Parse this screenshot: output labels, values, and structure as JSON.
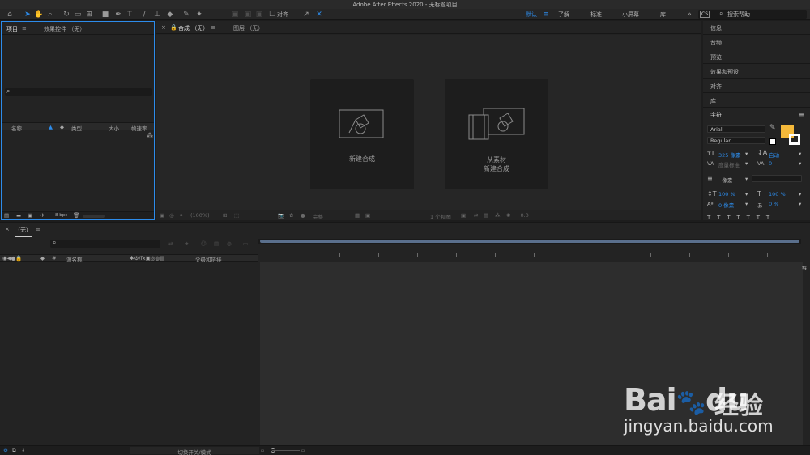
{
  "window": {
    "title": "Adobe After Effects 2020 - 无标题项目"
  },
  "toolbar": {
    "snap_label": "对齐",
    "workspaces": [
      "默认",
      "了解",
      "标准",
      "小屏幕",
      "库"
    ],
    "active_workspace": "默认",
    "search_placeholder": "搜索帮助"
  },
  "project_panel": {
    "tabs": [
      "项目",
      "效果控件 （无）"
    ],
    "columns": [
      "名称",
      "类型",
      "大小",
      "帧速率"
    ],
    "footer_bpc": "8 bpc"
  },
  "comp_panel": {
    "tabs": [
      "合成 （无）",
      "图层 （无）"
    ],
    "cards": [
      {
        "label_lines": [
          "新建合成"
        ]
      },
      {
        "label_lines": [
          "从素材",
          "新建合成"
        ]
      }
    ],
    "footer": {
      "zoom": "(100%)",
      "quality": "完整",
      "views": "1 个视图",
      "exposure": "+0.0"
    }
  },
  "right_panel": {
    "items": [
      "信息",
      "音频",
      "预览",
      "效果和预设",
      "对齐",
      "库"
    ],
    "character": {
      "title": "字符",
      "font": "Arial",
      "style": "Regular",
      "size": "325 像素",
      "leading": "自动",
      "kerning": "度量标准",
      "tracking": "0",
      "stroke": "- 像素",
      "vscale": "100 %",
      "hscale": "100 %",
      "baseline": "0 像素",
      "tsume": "0 %"
    },
    "fill_color": "#f5b93a"
  },
  "timeline": {
    "tab": "（无）",
    "columns": [
      "源名称",
      "父级和链接"
    ],
    "footer_mode": "切换开关/模式"
  },
  "watermark": {
    "brand": "Bai",
    "brand_mid": "du",
    "brand_cn": "经验",
    "url": "jingyan.baidu.com"
  }
}
